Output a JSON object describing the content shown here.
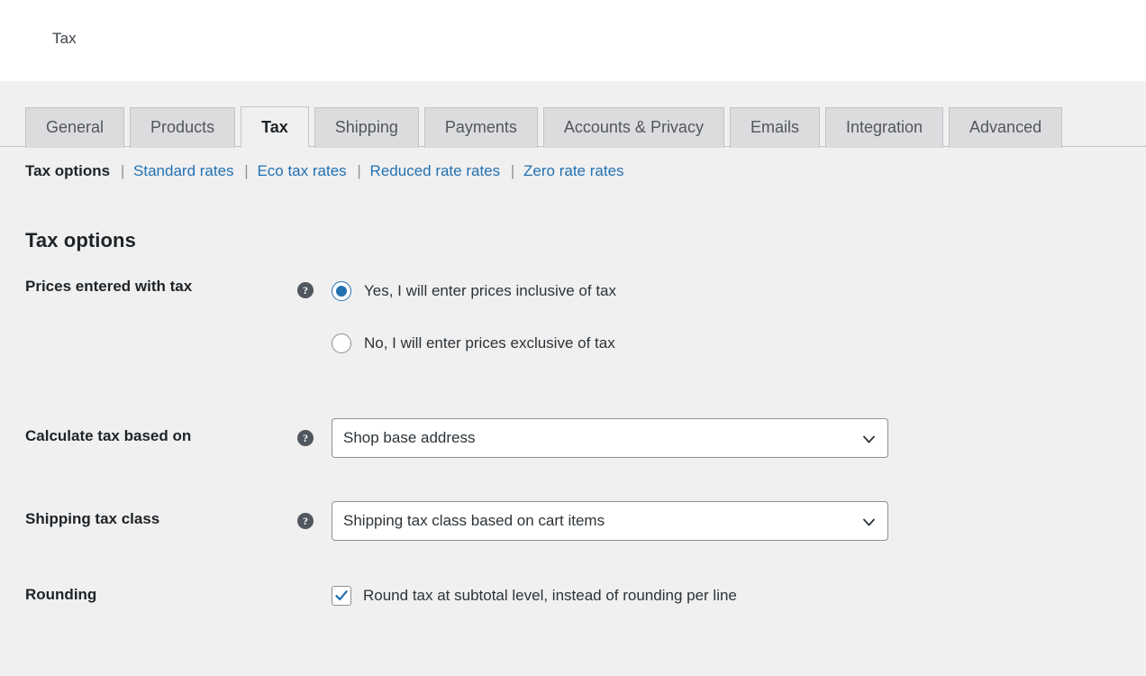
{
  "header": {
    "title": "Tax"
  },
  "tabs": [
    {
      "label": "General",
      "active": false
    },
    {
      "label": "Products",
      "active": false
    },
    {
      "label": "Tax",
      "active": true
    },
    {
      "label": "Shipping",
      "active": false
    },
    {
      "label": "Payments",
      "active": false
    },
    {
      "label": "Accounts & Privacy",
      "active": false
    },
    {
      "label": "Emails",
      "active": false
    },
    {
      "label": "Integration",
      "active": false
    },
    {
      "label": "Advanced",
      "active": false
    }
  ],
  "subnav": {
    "items": [
      {
        "label": "Tax options",
        "current": true
      },
      {
        "label": "Standard rates",
        "current": false
      },
      {
        "label": "Eco tax rates",
        "current": false
      },
      {
        "label": "Reduced rate rates",
        "current": false
      },
      {
        "label": "Zero rate rates",
        "current": false
      }
    ],
    "separator": "|"
  },
  "section": {
    "title": "Tax options"
  },
  "help_icon_glyph": "?",
  "fields": {
    "prices_entered_with_tax": {
      "label": "Prices entered with tax",
      "help": "?",
      "options": [
        {
          "label": "Yes, I will enter prices inclusive of tax",
          "selected": true
        },
        {
          "label": "No, I will enter prices exclusive of tax",
          "selected": false
        }
      ]
    },
    "calculate_tax_based_on": {
      "label": "Calculate tax based on",
      "help": "?",
      "value": "Shop base address"
    },
    "shipping_tax_class": {
      "label": "Shipping tax class",
      "help": "?",
      "value": "Shipping tax class based on cart items"
    },
    "rounding": {
      "label": "Rounding",
      "checkbox_label": "Round tax at subtotal level, instead of rounding per line",
      "checked": true
    }
  },
  "colors": {
    "page_background": "#f0f0f1",
    "link": "#2271b1",
    "accent": "#2271b1",
    "tab_inactive": "#dcdcde",
    "text_strong": "#1d2327"
  }
}
